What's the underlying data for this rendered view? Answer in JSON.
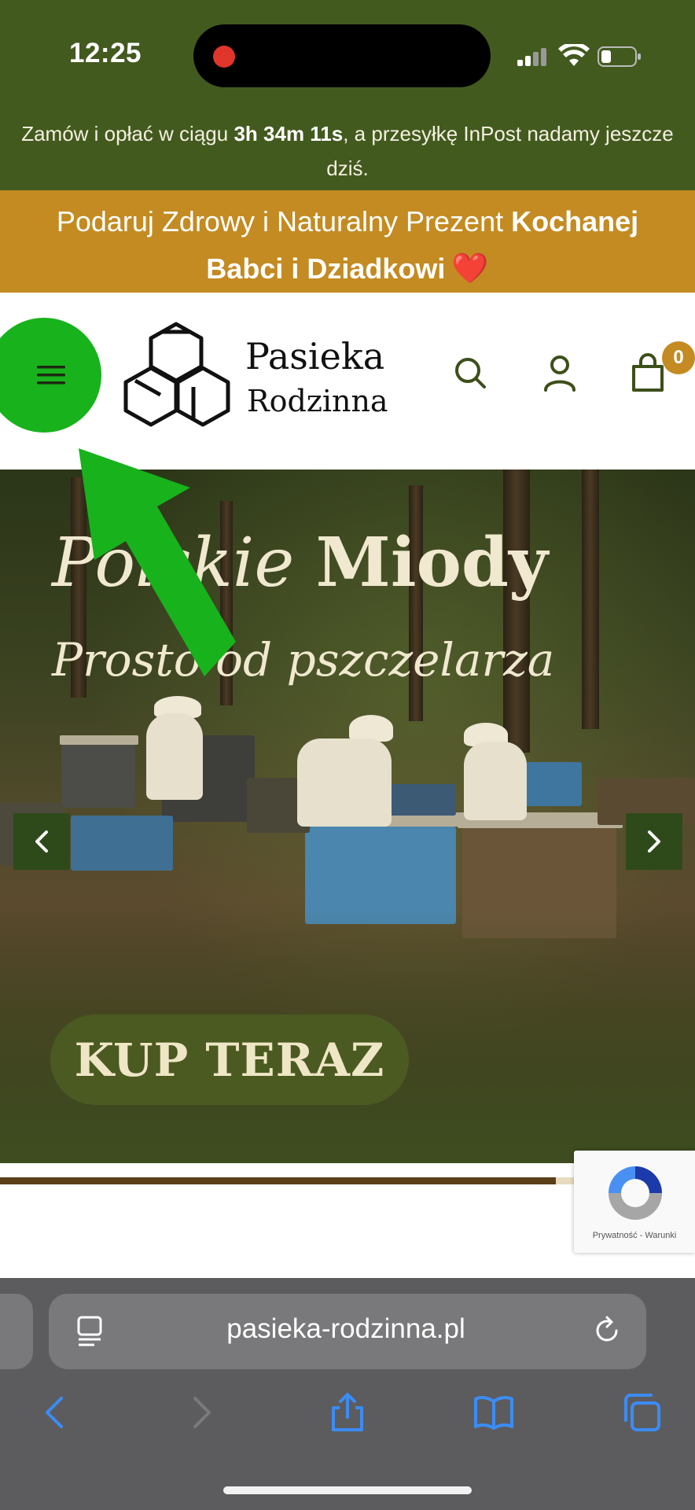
{
  "status_bar": {
    "time": "12:25"
  },
  "promo": {
    "text_before": "Zamów i opłać w ciągu ",
    "countdown": "3h 34m 11s",
    "text_after": ", a przesyłkę InPost nadamy jeszcze dziś."
  },
  "gift_banner": {
    "text_regular": "Podaruj Zdrowy i Naturalny Prezent ",
    "text_bold": "Kochanej Babci i Dziadkowi",
    "emoji": "❤️"
  },
  "header": {
    "logo_line1": "Pasieka",
    "logo_line2": "Rodzinna",
    "cart_count": "0"
  },
  "hero": {
    "title_italic": "Polskie",
    "title_bold": "Miody",
    "subtitle": "Prosto od pszczelarza",
    "cta": "KUP TERAZ",
    "slider_progress": 0.8
  },
  "recaptcha": {
    "text": "Prywatność - Warunki"
  },
  "browser": {
    "url": "pasieka-rodzinna.pl"
  },
  "colors": {
    "top_bar": "#435a1f",
    "gift_banner": "#c38b22",
    "menu_highlight": "#18b21c",
    "cta": "#4a5a20",
    "icon_green": "#3d4f1a"
  },
  "icons": [
    "menu-icon",
    "search-icon",
    "user-icon",
    "cart-icon",
    "chevron-left-icon",
    "chevron-right-icon",
    "reader-icon",
    "reload-icon",
    "back-icon",
    "forward-icon",
    "share-icon",
    "bookmarks-icon",
    "tabs-icon"
  ]
}
